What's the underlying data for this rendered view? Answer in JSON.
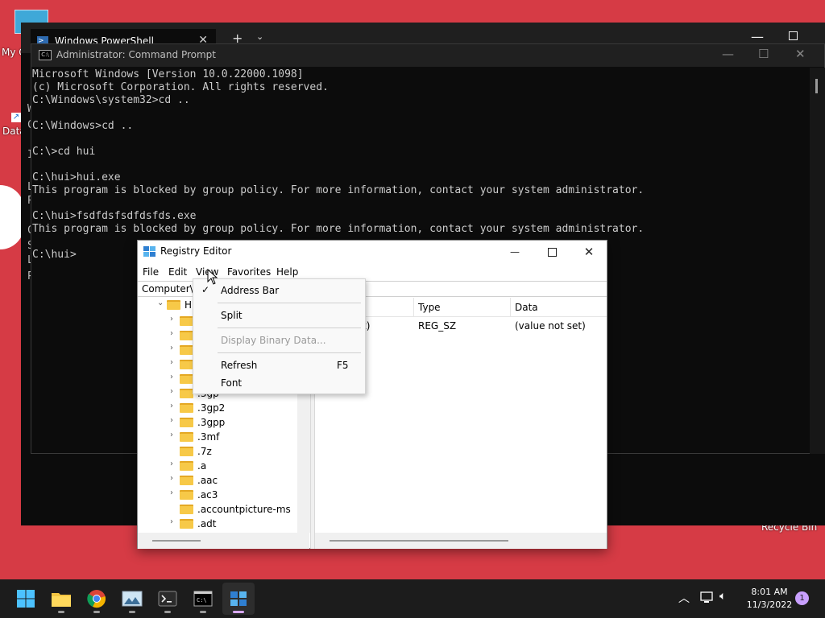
{
  "desktop": {
    "icon_label_1": "My C",
    "icon_label_2": "Data",
    "recycle_bin": "Recycle Bin"
  },
  "powershell": {
    "tab_title": "Windows PowerShell",
    "side_letters": [
      "W",
      "C",
      "I",
      "L",
      "P",
      "C",
      "S",
      "L",
      "P"
    ]
  },
  "cmd": {
    "title": "Administrator: Command Prompt",
    "lines": [
      "Microsoft Windows [Version 10.0.22000.1098]",
      "(c) Microsoft Corporation. All rights reserved.",
      "C:\\Windows\\system32>cd ..",
      "",
      "C:\\Windows>cd ..",
      "",
      "C:\\>cd hui",
      "",
      "C:\\hui>hui.exe",
      "This program is blocked by group policy. For more information, contact your system administrator.",
      "",
      "C:\\hui>fsdfdsfsdfdsfds.exe",
      "This program is blocked by group policy. For more information, contact your system administrator.",
      "",
      "C:\\hui>"
    ]
  },
  "regedit": {
    "title": "Registry Editor",
    "menu": [
      "File",
      "Edit",
      "View",
      "Favorites",
      "Help"
    ],
    "address": "Computer\\",
    "tree_root": "H",
    "tree_items": [
      "",
      "",
      "",
      "",
      "",
      ".3gp",
      ".3gp2",
      ".3gpp",
      ".3mf",
      ".7z",
      ".a",
      ".aac",
      ".ac3",
      ".accountpicture-ms",
      ".adt"
    ],
    "columns": [
      "Type",
      "Data"
    ],
    "rows": [
      {
        "name_fragment": "t)",
        "type": "REG_SZ",
        "data": "(value not set)"
      }
    ]
  },
  "view_menu": {
    "items": [
      {
        "label": "Address Bar",
        "checked": true,
        "shortcut": "",
        "disabled": false
      },
      {
        "label": "Split",
        "checked": false,
        "shortcut": "",
        "disabled": false
      },
      {
        "label": "Display Binary Data...",
        "checked": false,
        "shortcut": "",
        "disabled": true
      },
      {
        "label": "Refresh",
        "checked": false,
        "shortcut": "F5",
        "disabled": false
      },
      {
        "label": "Font",
        "checked": false,
        "shortcut": "",
        "disabled": false
      }
    ]
  },
  "taskbar": {
    "apps": [
      "start-icon",
      "file-explorer-icon",
      "chrome-icon",
      "photos-icon",
      "terminal-icon",
      "cmd-icon",
      "regedit-icon"
    ],
    "time": "8:01 AM",
    "date": "11/3/2022",
    "notification_count": "1"
  }
}
